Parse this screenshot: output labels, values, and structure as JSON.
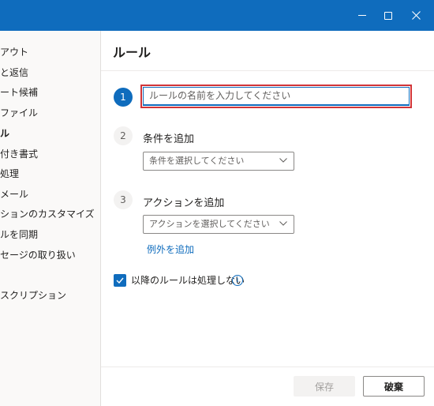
{
  "window": {
    "minimize_icon": "minimize-icon",
    "maximize_icon": "maximize-icon",
    "close_icon": "close-icon"
  },
  "sidebar": {
    "items": [
      {
        "label": "アウト"
      },
      {
        "label": "と返信"
      },
      {
        "label": "ート候補"
      },
      {
        "label": "ファイル"
      },
      {
        "label": "ル",
        "selected": true
      },
      {
        "label": "付き書式"
      },
      {
        "label": "処理"
      },
      {
        "label": "メール"
      },
      {
        "label": "ションのカスタマイズ"
      },
      {
        "label": "ルを同期"
      },
      {
        "label": "セージの取り扱い"
      },
      {
        "label": "スクリプション"
      }
    ]
  },
  "main": {
    "title": "ルール",
    "steps": [
      {
        "number": "1",
        "placeholder": "ルールの名前を入力してください"
      },
      {
        "number": "2",
        "label": "条件を追加",
        "dropdown": "条件を選択してください"
      },
      {
        "number": "3",
        "label": "アクションを追加",
        "dropdown": "アクションを選択してください"
      }
    ],
    "exception_link": "例外を追加",
    "stop_processing": {
      "label": "以降のルールは処理しない",
      "checked": true
    },
    "info_icon": "info-icon"
  },
  "footer": {
    "save_label": "保存",
    "discard_label": "破棄"
  },
  "colors": {
    "accent": "#0f6cbd",
    "highlight": "#d13438"
  }
}
